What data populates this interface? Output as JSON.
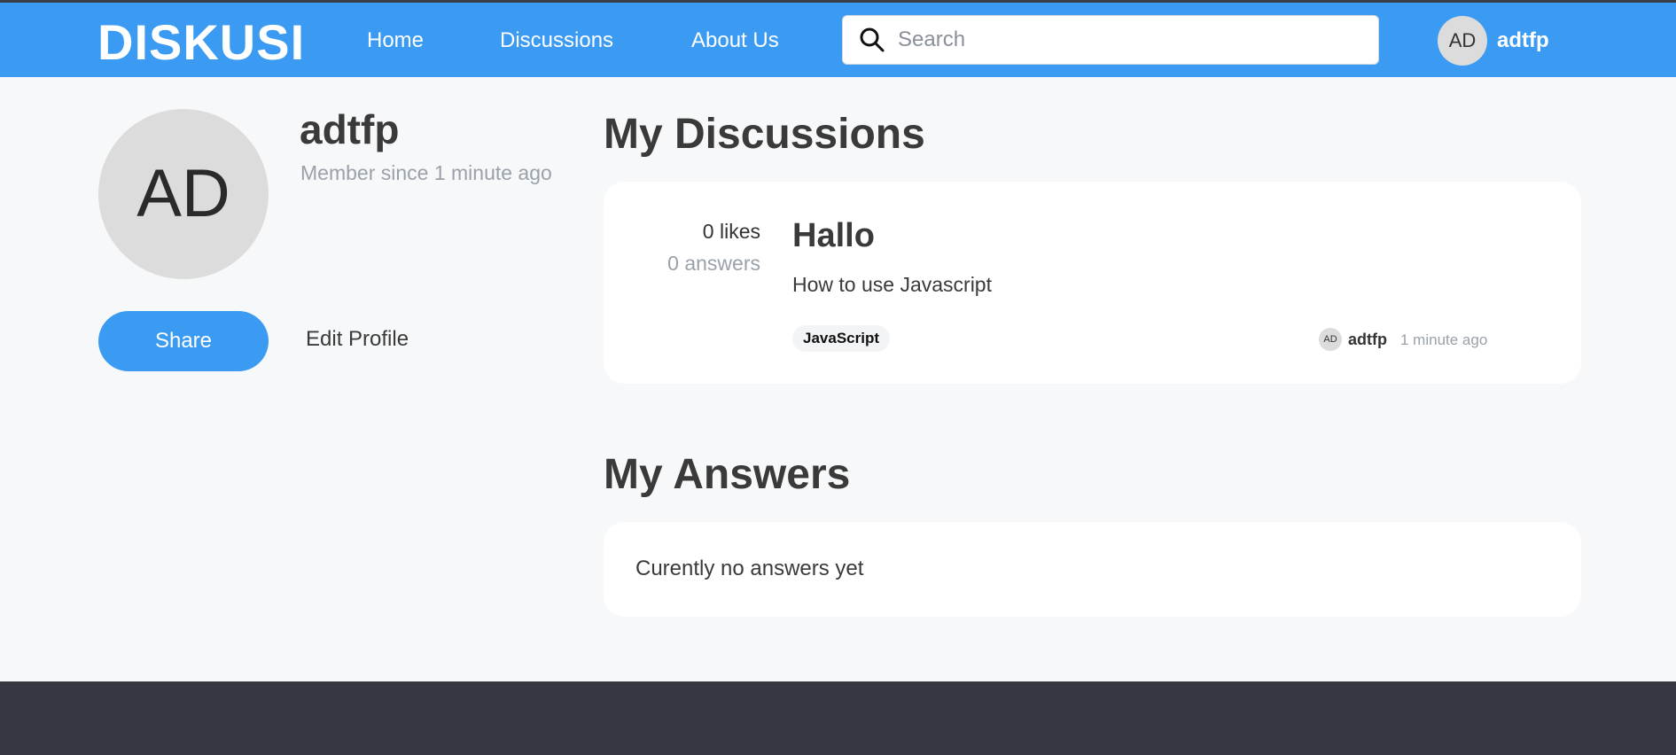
{
  "header": {
    "brand": "DISKUSI",
    "nav": {
      "home": "Home",
      "discussions": "Discussions",
      "about": "About Us"
    },
    "search": {
      "placeholder": "Search",
      "value": ""
    },
    "user": {
      "initials": "AD",
      "name": "adtfp"
    }
  },
  "profile": {
    "initials": "AD",
    "name": "adtfp",
    "member_since": "Member since 1 minute ago",
    "share_label": "Share",
    "edit_label": "Edit Profile"
  },
  "discussions": {
    "title": "My Discussions",
    "items": [
      {
        "likes": "0 likes",
        "answers": "0 answers",
        "title": "Hallo",
        "body": "How to use Javascript",
        "tag": "JavaScript",
        "author_initials": "AD",
        "author": "adtfp",
        "time": "1 minute ago"
      }
    ]
  },
  "answers": {
    "title": "My Answers",
    "empty_text": "Curently no answers yet"
  },
  "colors": {
    "primary": "#3b9bf2",
    "background": "#f7f8f9",
    "footer": "#353841",
    "muted": "#9aa1a9"
  }
}
